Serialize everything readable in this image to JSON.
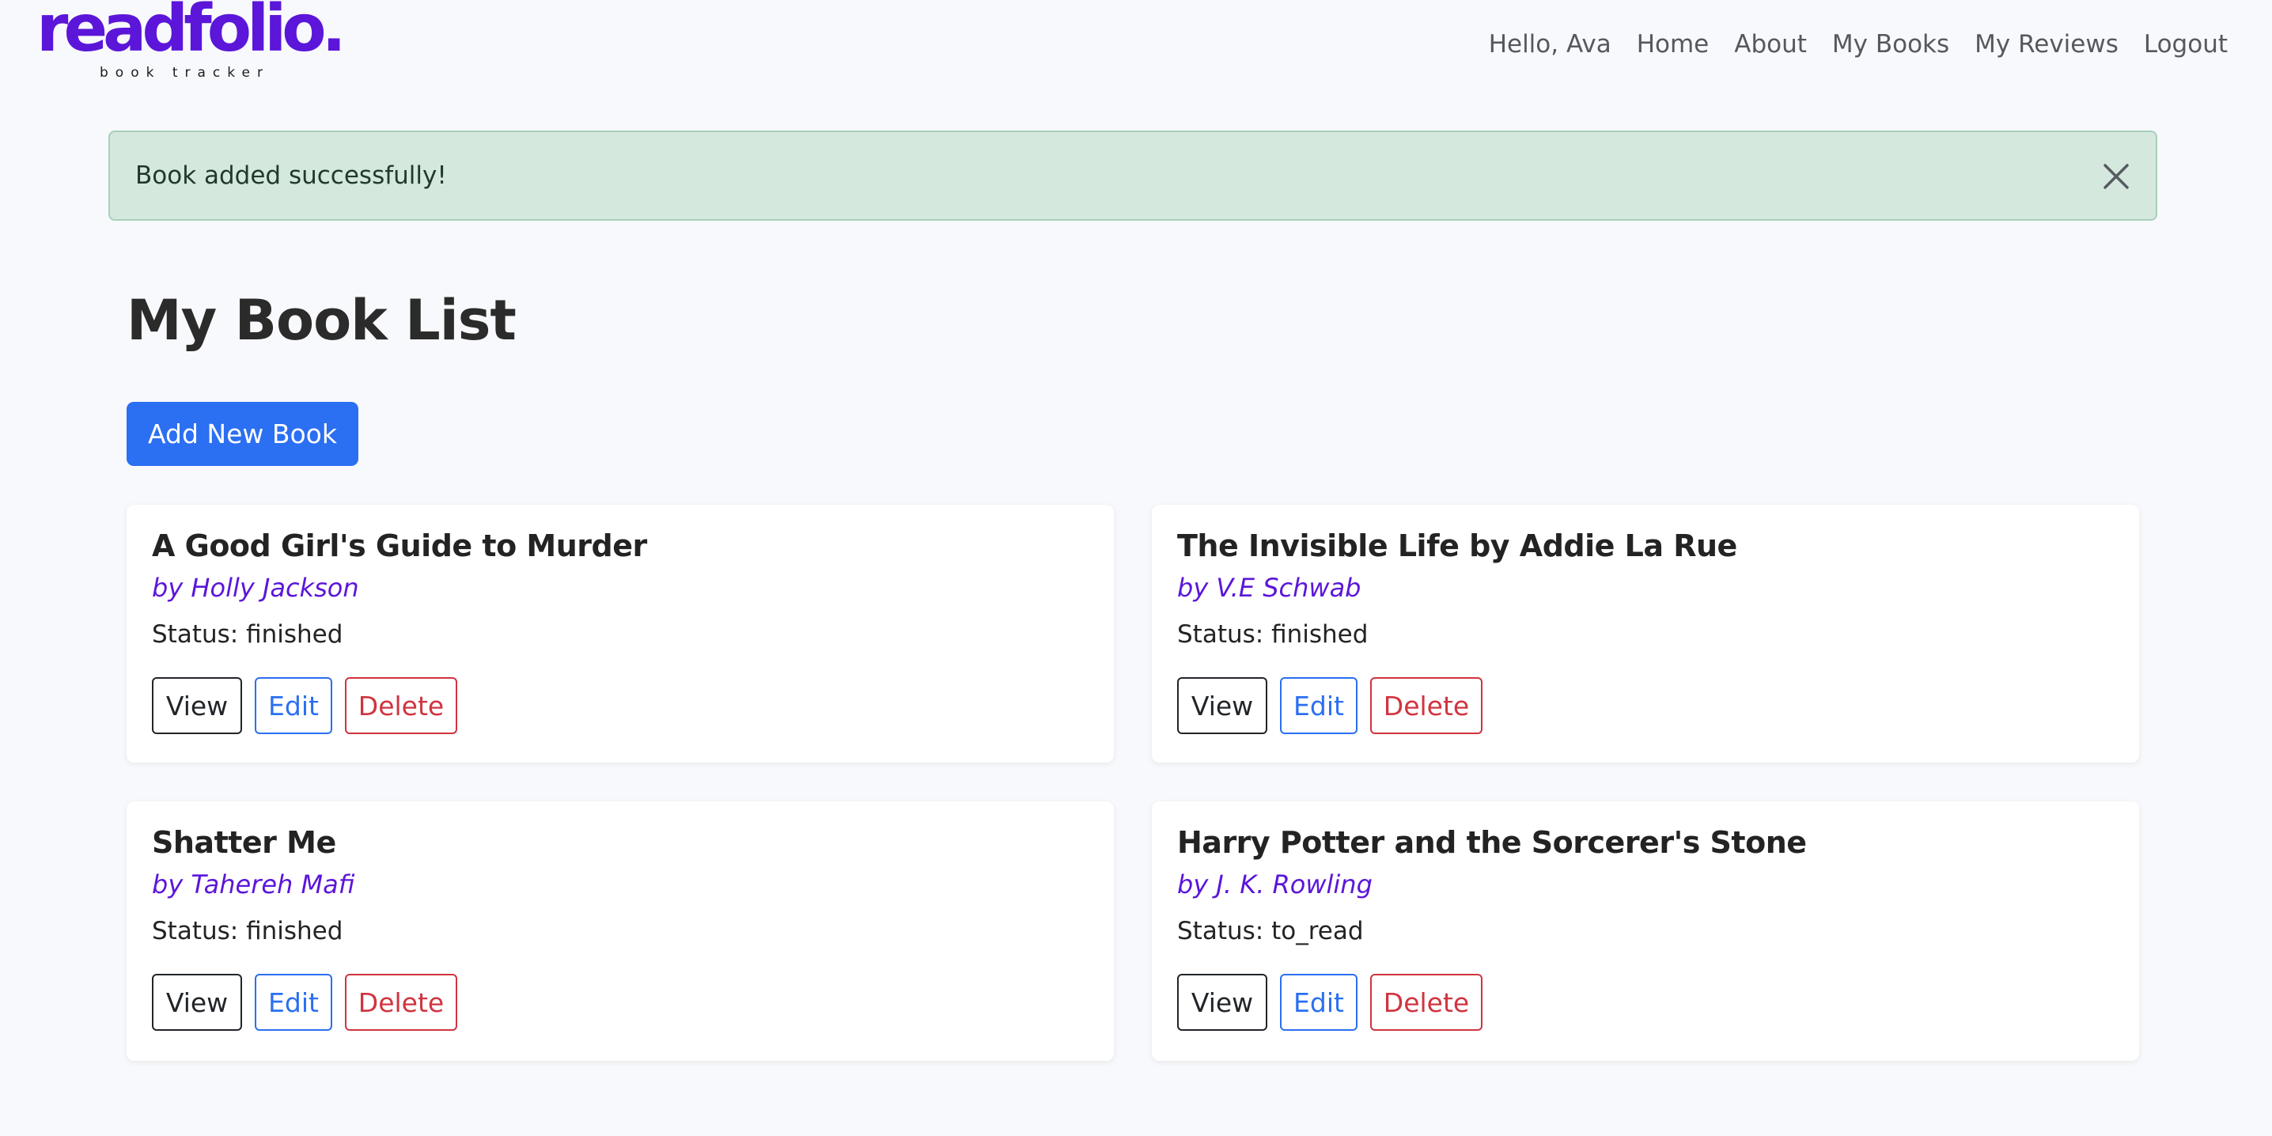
{
  "brand": {
    "name": "readfolio",
    "dot": ".",
    "tagline": "book tracker",
    "color": "#5b16d9"
  },
  "nav": {
    "greeting": "Hello, Ava",
    "links": [
      "Home",
      "About",
      "My Books",
      "My Reviews",
      "Logout"
    ]
  },
  "alert": {
    "message": "Book added successfully!",
    "close_icon": "close-icon",
    "type": "success"
  },
  "main": {
    "title": "My Book List",
    "add_button": "Add New Book"
  },
  "books": [
    {
      "title": "A Good Girl's Guide to Murder",
      "author": "by Holly Jackson",
      "status": "Status: finished"
    },
    {
      "title": "The Invisible Life by Addie La Rue",
      "author": "by V.E Schwab",
      "status": "Status: finished"
    },
    {
      "title": "Shatter Me",
      "author": "by Tahereh Mafi",
      "status": "Status: finished"
    },
    {
      "title": "Harry Potter and the Sorcerer's Stone",
      "author": "by J. K. Rowling",
      "status": "Status: to_read"
    }
  ],
  "actions": {
    "view": "View",
    "edit": "Edit",
    "delete": "Delete"
  },
  "colors": {
    "primary": "#2b6ff2",
    "danger": "#d0343f",
    "accent": "#5b16d9",
    "alert_bg": "#d5e8de"
  }
}
